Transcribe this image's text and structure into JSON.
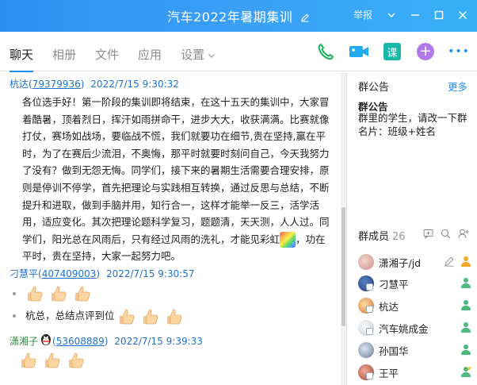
{
  "window": {
    "title": "汽车2022年暑期集训",
    "report_label": "举报"
  },
  "tabs": [
    {
      "label": "聊天"
    },
    {
      "label": "相册"
    },
    {
      "label": "文件"
    },
    {
      "label": "应用"
    },
    {
      "label": "设置"
    }
  ],
  "toolbar": {
    "class_label": "课",
    "plus_label": "+",
    "more_label": "•••"
  },
  "messages": [
    {
      "sender": "杭达",
      "uid": "79379936",
      "time": "2022/7/15 9:30:32",
      "text": "各位选手好！第一阶段的集训即将结束，在这十五天的集训中，大家冒着酷暑，顶着烈日，挥汗如雨拼命干，进步大大，收获满满。比赛就像打仗，赛场如战场，要临战不慌，我们就要功在细节,贵在坚持,赢在平时，为了在赛后少流泪，不奥悔，那平时就要时刻问自己，今天我努力了没有？做到无怨无悔。同学们，接下来的暑期生活需要合理安排，原则是停训不停学，首先把理论与实践相互转换，通过反思与总结，不断提升和进取，做到手脑并用，知行合一，这样才能举一反三，活学活用，适应变化。其次把理论题科学复习，题题清，天天测，人人过。同学们，阳光总在风雨后，只有经过风雨的洗礼，才能见彩虹",
      "text_tail": "，功在平时，贵在坚持，大家一起努力吧。"
    },
    {
      "sender": "刁慧平",
      "uid": "407409003",
      "time": "2022/7/15 9:30:57",
      "line2": "杭总，总结点评到位"
    },
    {
      "sender": "潇湘子",
      "uid": "53608889",
      "time": "2022/7/15 9:39:33"
    }
  ],
  "notice": {
    "header": "群公告",
    "more": "更多",
    "title": "群公告",
    "body": "群里的学生，请改一下群名片：班级+姓名"
  },
  "members": {
    "header": "群成员",
    "count": "26",
    "list": [
      {
        "name": "潇湘子/jd",
        "role": "owner"
      },
      {
        "name": "刁慧平",
        "role": "admin"
      },
      {
        "name": "杭达",
        "role": "admin"
      },
      {
        "name": "汽车姚成金",
        "role": "admin"
      },
      {
        "name": "孙国华",
        "role": "admin"
      },
      {
        "name": "王平",
        "role": "admin-star"
      }
    ]
  },
  "colors": {
    "title_bar": "#2d8ff2",
    "accent": "#1e90f0",
    "link": "#1f72d0",
    "green_name": "#2a8a3a"
  }
}
